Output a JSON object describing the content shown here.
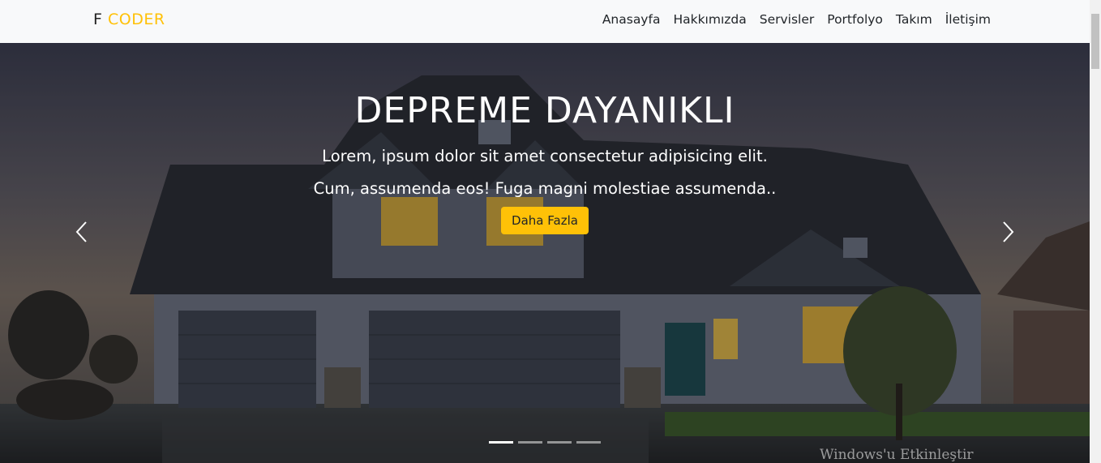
{
  "navbar": {
    "brand_prefix": "F ",
    "brand_accent": "CODER",
    "links": [
      {
        "label": "Anasayfa"
      },
      {
        "label": "Hakkımızda"
      },
      {
        "label": "Servisler"
      },
      {
        "label": "Portfolyo"
      },
      {
        "label": "Takım"
      },
      {
        "label": "İletişim"
      }
    ]
  },
  "hero": {
    "title": "DEPREME DAYANIKLI",
    "text": "Lorem, ipsum dolor sit amet consectetur adipisicing elit. Cum, assumenda eos! Fuga magni molestiae assumenda..",
    "button_label": "Daha Fazla",
    "slides_count": 4,
    "active_slide": 1
  },
  "watermark": "Windows'u Etkinleştir",
  "colors": {
    "accent": "#ffc107",
    "navbar_bg": "#f8f9fa",
    "text_dark": "#212529"
  },
  "icons": {
    "prev": "chevron-left-icon",
    "next": "chevron-right-icon"
  }
}
